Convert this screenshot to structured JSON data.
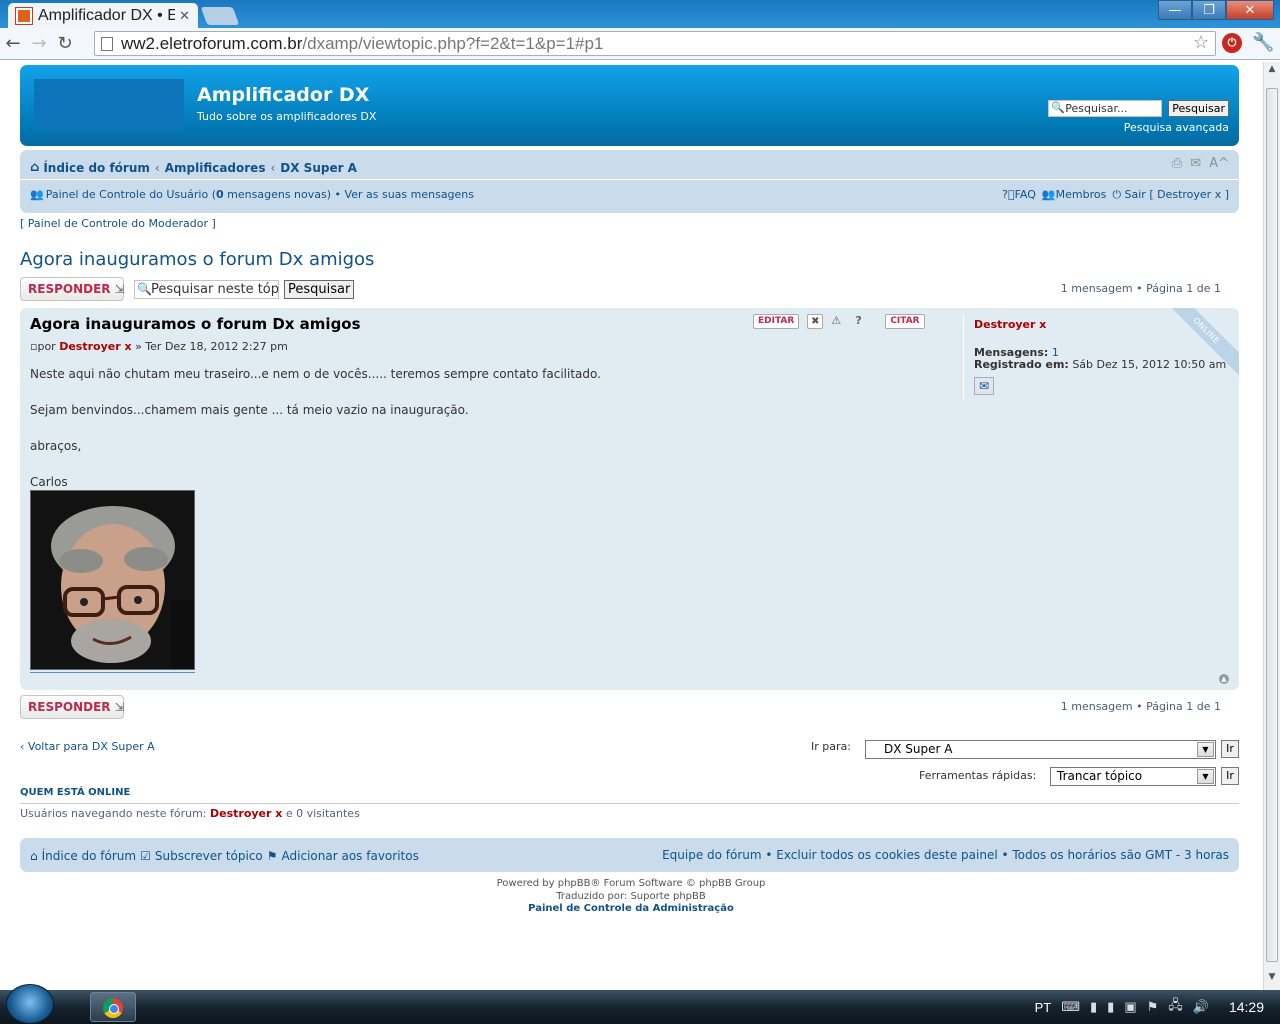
{
  "browser": {
    "tab_title": "Amplificador DX • Ex",
    "tab_close": "✕",
    "url_host": "ww2.eletroforum.com.br",
    "url_path": "/dxamp/viewtopic.php?f=2&t=1&p=1#p1",
    "win_min": "—",
    "win_max": "❐",
    "win_close": "✕"
  },
  "header": {
    "site_title": "Amplificador DX",
    "site_desc": "Tudo sobre os amplificadores DX",
    "search_placeholder": "Pesquisar...",
    "search_button": "Pesquisar",
    "advanced_search": "Pesquisa avançada"
  },
  "nav": {
    "crumbs": [
      "Índice do fórum",
      "Amplificadores",
      "DX Super A"
    ],
    "crumb_sep": "‹",
    "ucp_text_pre": "Painel de Controle do Usuário (",
    "ucp_count": "0",
    "ucp_text_post": " mensagens novas)",
    "bullet": "•",
    "view_messages": "Ver as suas mensagens",
    "faq": "FAQ",
    "members": "Membros",
    "logout": "Sair [ Destroyer x ]",
    "mcp": "[ Painel de Controle do Moderador ]"
  },
  "topic": {
    "title": "Agora inauguramos o forum Dx amigos",
    "reply_label": "RESPONDER",
    "search_value": "Pesquisar neste tópico",
    "search_button": "Pesquisar",
    "page_info": "1 mensagem • Página 1 de 1"
  },
  "post": {
    "title": "Agora inauguramos o forum Dx amigos",
    "edit": "EDITAR",
    "quote": "CITAR",
    "by_prefix": "por",
    "author": "Destroyer x",
    "date": "» Ter Dez 18, 2012 2:27 pm",
    "paragraphs": [
      "Neste aqui não chutam meu traseiro...e nem o de vocês..... teremos sempre contato facilitado.",
      "Sejam benvindos...chamem mais gente ... tá meio vazio na inauguração.",
      "abraços,",
      "Carlos"
    ],
    "online_badge": "ONLINE",
    "profile": {
      "username": "Destroyer x",
      "posts_label": "Mensagens:",
      "posts_value": "1",
      "registered_label": "Registrado em:",
      "registered_value": "Sáb Dez 15, 2012 10:50 am"
    }
  },
  "bottom": {
    "back_link": "Voltar para DX Super A",
    "jump_label": "Ir para:",
    "jump_value": "DX Super A",
    "go": "Ir",
    "quick_tools_label": "Ferramentas rápidas:",
    "quick_tools_value": "Trancar tópico"
  },
  "who": {
    "heading": "QUEM ESTÁ ONLINE",
    "text_pre": "Usuários navegando neste fórum:",
    "user": "Destroyer x",
    "text_post": "e 0 visitantes"
  },
  "footer": {
    "index": "Índice do fórum",
    "subscribe": "Subscrever tópico",
    "bookmark": "Adicionar aos favoritos",
    "right": "Equipe do fórum • Excluir todos os cookies deste painel • Todos os horários são GMT - 3 horas",
    "powered": "Powered by phpBB® Forum Software © phpBB Group",
    "translated": "Traduzido por: Suporte phpBB",
    "acp": "Painel de Controle da Administração"
  },
  "taskbar": {
    "lang": "PT",
    "time": "14:29"
  }
}
